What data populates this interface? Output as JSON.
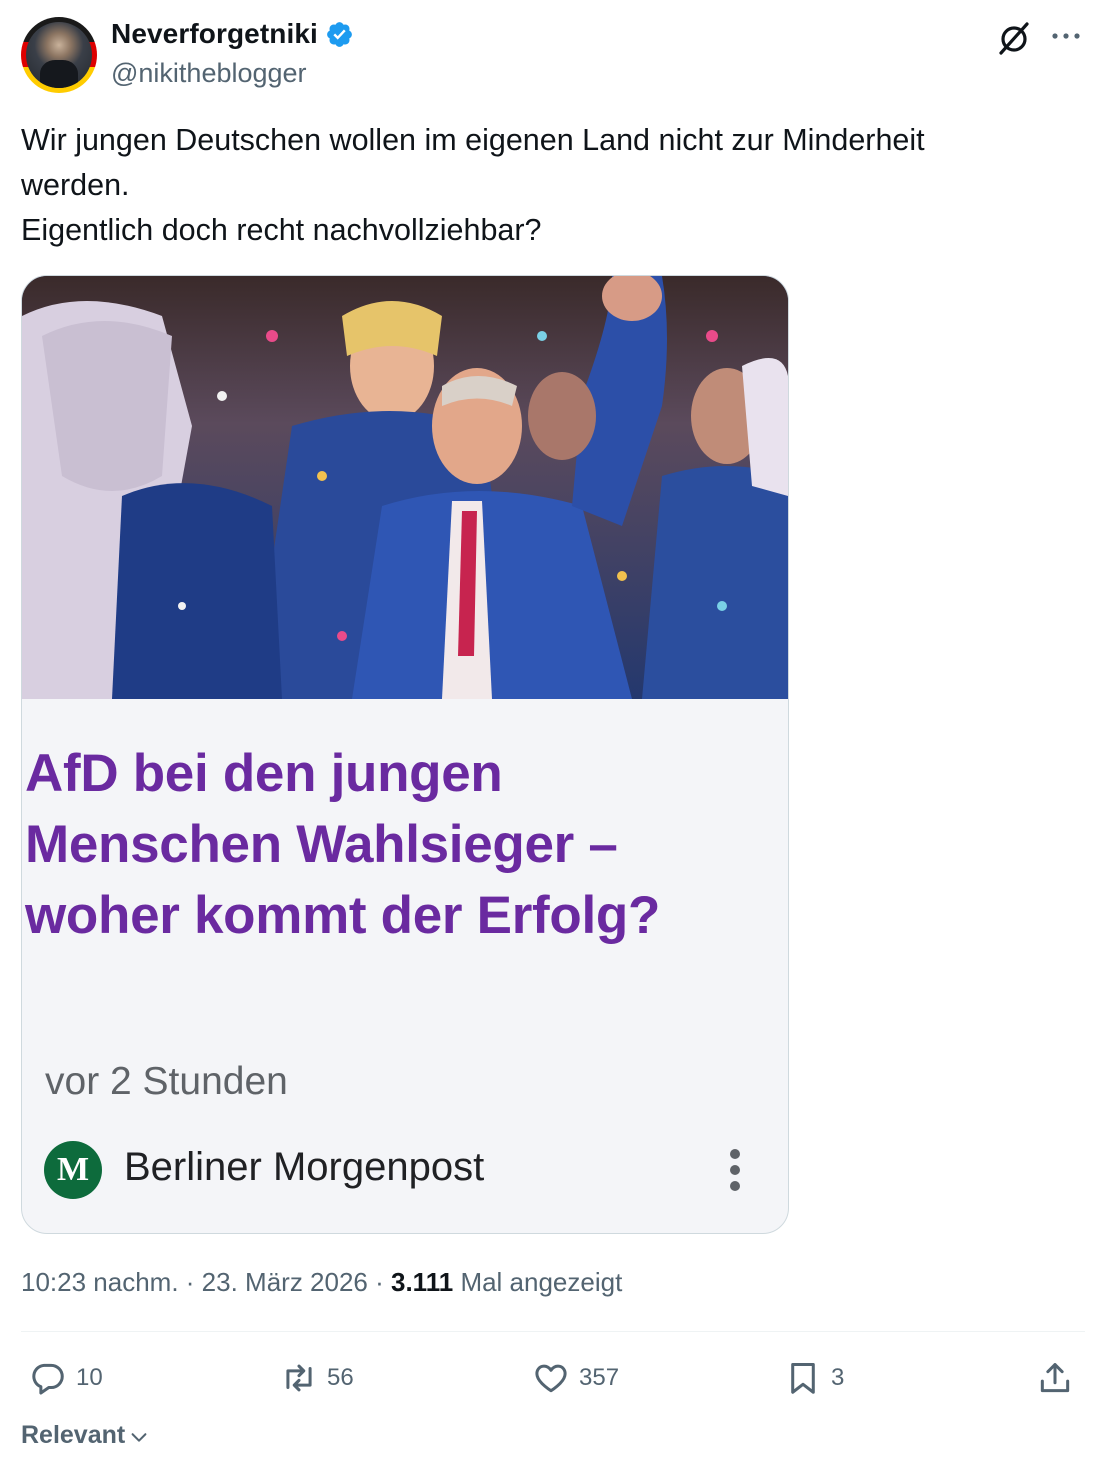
{
  "author": {
    "name": "Neverforgetniki",
    "handle": "@nikitheblogger",
    "verified": true
  },
  "icons": {
    "verified": "verified-badge-icon",
    "grok": "grok-icon",
    "more": "more-horizontal-icon",
    "reply": "reply-icon",
    "retweet": "retweet-icon",
    "like": "heart-icon",
    "bookmark": "bookmark-icon",
    "share": "share-icon",
    "sort": "chevron-down-icon"
  },
  "tweet": {
    "lines": [
      "Wir jungen Deutschen wollen im eigenen Land nicht zur Minderheit",
      "werden.",
      "Eigentlich doch recht nachvollziehbar?"
    ]
  },
  "card": {
    "headline_lines": [
      "AfD bei den jungen",
      "Menschen Wahlsieger –",
      "woher kommt der Erfolg?"
    ],
    "time_ago": "vor 2 Stunden",
    "publisher_logo_letter": "M",
    "publisher": "Berliner Morgenpost"
  },
  "meta": {
    "time": "10:23 nachm.",
    "separator": " · ",
    "date": "23. März 2026",
    "views_count": "3.111",
    "views_label": "Mal angezeigt"
  },
  "actions": {
    "replies": "10",
    "retweets": "56",
    "likes": "357",
    "bookmarks": "3"
  },
  "sort": {
    "label": "Relevant"
  },
  "colors": {
    "text": "#0f1419",
    "secondary": "#536471",
    "verified": "#1d9bf0",
    "headline": "#6a2aa0",
    "publisher_logo": "#0d6b3c",
    "card_bg": "#f4f5f8",
    "border": "#cfd9de"
  }
}
